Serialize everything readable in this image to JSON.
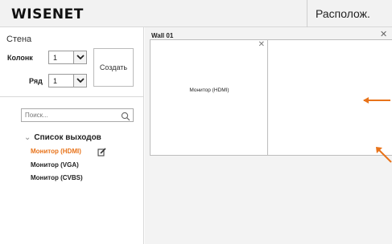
{
  "header": {
    "logo_text": "WISENET",
    "tab_label": "Располож."
  },
  "left": {
    "section_title": "Стена",
    "columns_label": "Колонк",
    "columns_value": "1",
    "rows_label": "Ряд",
    "rows_value": "1",
    "create_label": "Создать",
    "search_placeholder": "Поиск...",
    "outputs_title": "Список выходов",
    "outputs": [
      {
        "label": "Монитор (HDMI)",
        "active": true
      },
      {
        "label": "Монитор (VGA)",
        "active": false
      },
      {
        "label": "Монитор (CVBS)",
        "active": false
      }
    ]
  },
  "main": {
    "wall_title": "Wall 01",
    "cell_1_label": "Монитор (HDMI)"
  },
  "colors": {
    "accent": "#e8731a",
    "selected_output": "#e8731a"
  },
  "icons": [
    "chevron-down-icon",
    "search-icon",
    "edit-icon",
    "close-icon",
    "arrow-left-icon",
    "arrow-resize-icon"
  ]
}
